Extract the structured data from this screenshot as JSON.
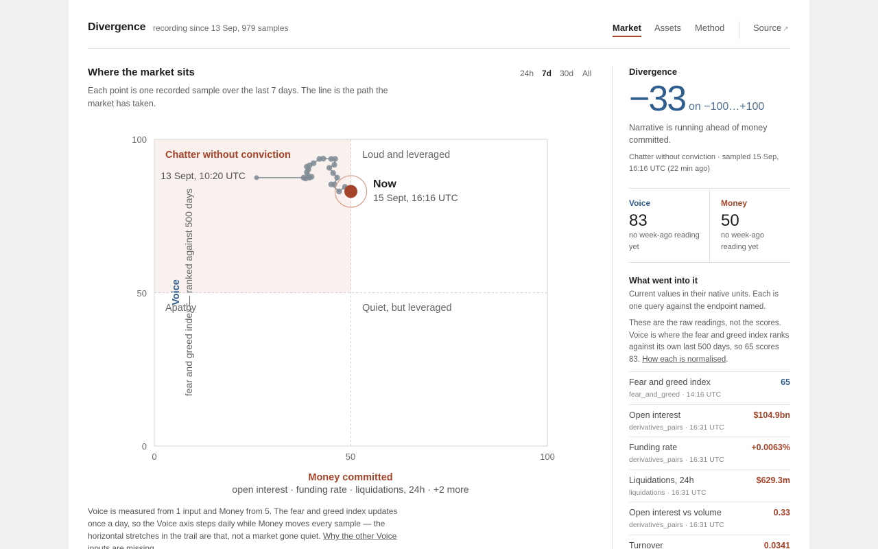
{
  "header": {
    "title": "Divergence",
    "recording": "recording since 13 Sep, 979 samples",
    "nav": [
      "Market",
      "Assets",
      "Method"
    ],
    "source": "Source"
  },
  "main": {
    "title": "Where the market sits",
    "ranges": [
      "24h",
      "7d",
      "30d",
      "All"
    ],
    "active_range": "7d",
    "description": "Each point is one recorded sample over the last 7 days. The line is the path the market has taken.",
    "footnote_text": "Voice is measured from 1 input and Money from 5. The fear and greed index updates once a day, so the Voice axis steps daily while Money moves every sample — the horizontal stretches in the trail are that, not a market gone quiet. ",
    "footnote_link": "Why the other Voice inputs are missing."
  },
  "chart_data": {
    "type": "scatter",
    "xlabel": "Money committed",
    "xsub": "open interest · funding rate · liquidations, 24h · +2 more",
    "ylabel": "Voice",
    "ysub": "fear and greed index — ranked against 500 days",
    "xlim": [
      0,
      100
    ],
    "ylim": [
      0,
      100
    ],
    "xticks": [
      "0",
      "50",
      "100"
    ],
    "yticks": [
      "0",
      "50",
      "100"
    ],
    "quadrants": {
      "top_left": "Chatter without conviction",
      "top_right": "Loud and leveraged",
      "bottom_left": "Apathy",
      "bottom_right": "Quiet, but leveraged"
    },
    "start_label": "13 Sept, 10:20 UTC",
    "now_label": "Now",
    "now_time": "15 Sept, 16:16 UTC",
    "trail": [
      [
        26,
        87.5
      ],
      [
        38,
        87.5
      ],
      [
        38.5,
        87.2
      ],
      [
        39.5,
        87.5
      ],
      [
        40,
        87.8
      ],
      [
        39,
        88.3
      ],
      [
        38.8,
        89.3
      ],
      [
        39.2,
        90.2
      ],
      [
        38.8,
        91.1
      ],
      [
        39.5,
        91.5
      ],
      [
        40.5,
        92.2
      ],
      [
        42,
        93.6
      ],
      [
        43,
        93.7
      ],
      [
        45,
        93.6
      ],
      [
        46,
        93.6
      ],
      [
        45.8,
        91.7
      ],
      [
        44.5,
        90.7
      ],
      [
        45.5,
        89
      ],
      [
        46.5,
        87.5
      ],
      [
        45.8,
        85.3
      ],
      [
        45,
        85.3
      ],
      [
        47,
        83
      ],
      [
        48.5,
        84.5
      ],
      [
        50,
        83
      ]
    ],
    "now": [
      50,
      83
    ],
    "colors": {
      "voice": "#2f5d8d",
      "money": "#a3432a",
      "trail": "#7f8b94",
      "quadrant_fill": "#f8f1ee"
    }
  },
  "side": {
    "label": "Divergence",
    "value": "−33",
    "scale": "on −100…+100",
    "description": "Narrative is running ahead of money committed.",
    "sampled": "Chatter without conviction · sampled 15 Sep, 16:16 UTC (22 min ago)",
    "voice": {
      "label": "Voice",
      "value": "83",
      "note": "no week-ago reading yet"
    },
    "money": {
      "label": "Money",
      "value": "50",
      "note": "no week-ago reading yet"
    },
    "inputs_title": "What went into it",
    "inputs_p1": "Current values in their native units. Each is one query against the endpoint named.",
    "inputs_p2": "These are the raw readings, not the scores. Voice is where the fear and greed index ranks against its own last 500 days, so 65 scores 83. ",
    "inputs_link": "How each is normalised",
    "readings": [
      {
        "name": "Fear and greed index",
        "source": "fear_and_greed · 14:16 UTC",
        "value": "65",
        "kind": "voice"
      },
      {
        "name": "Open interest",
        "source": "derivatives_pairs · 16:31 UTC",
        "value": "$104.9bn",
        "kind": "money"
      },
      {
        "name": "Funding rate",
        "source": "derivatives_pairs · 16:31 UTC",
        "value": "+0.0063%",
        "kind": "money"
      },
      {
        "name": "Liquidations, 24h",
        "source": "liquidations · 16:31 UTC",
        "value": "$629.3m",
        "kind": "money"
      },
      {
        "name": "Open interest vs volume",
        "source": "derivatives_pairs · 16:31 UTC",
        "value": "0.33",
        "kind": "money"
      },
      {
        "name": "Turnover",
        "source": "",
        "value": "0.0341",
        "kind": "money"
      }
    ]
  }
}
